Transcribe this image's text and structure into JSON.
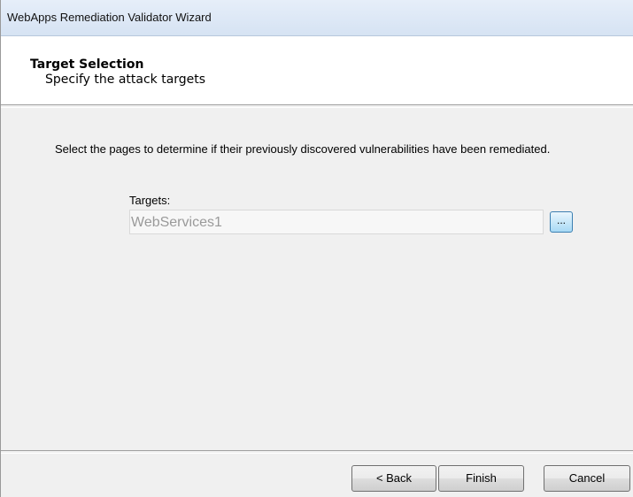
{
  "window": {
    "title": "WebApps Remediation Validator Wizard"
  },
  "header": {
    "title": "Target Selection",
    "subtitle": "Specify the attack targets"
  },
  "main": {
    "description": "Select the pages to determine if their previously discovered vulnerabilities have been remediated.",
    "targets_label": "Targets:",
    "targets_value": "WebServices1",
    "browse_label": "..."
  },
  "footer": {
    "back_label": "< Back",
    "finish_label": "Finish",
    "cancel_label": "Cancel"
  }
}
